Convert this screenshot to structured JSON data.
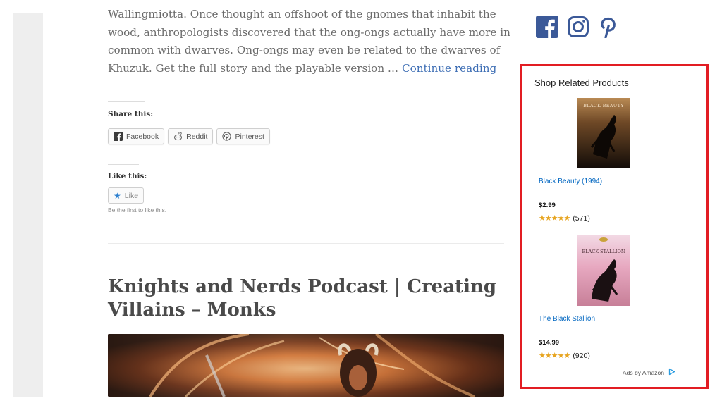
{
  "article": {
    "excerpt_lines": [
      "Wallingmiotta. Once thought an offshoot of the gnomes that inhabit the",
      "wood, anthropologists discovered that the ong-ongs actually have more in",
      "common with dwarves. Ong-ongs may even be related to the dwarves of",
      "Khuzuk. Get the full story and the playable version …"
    ],
    "continue_reading": "Continue reading"
  },
  "share": {
    "title": "Share this:",
    "buttons": [
      {
        "label": "Facebook",
        "icon": "facebook-icon"
      },
      {
        "label": "Reddit",
        "icon": "reddit-icon"
      },
      {
        "label": "Pinterest",
        "icon": "pinterest-icon"
      }
    ]
  },
  "like": {
    "title": "Like this:",
    "button_label": "Like",
    "note": "Be the first to like this."
  },
  "next_post": {
    "title_line1": "Knights and Nerds Podcast | Creating",
    "title_line2": "Villains – Monks"
  },
  "social": {
    "icons": [
      "facebook-icon",
      "instagram-icon",
      "pinterest-icon"
    ],
    "color": "#3b5998"
  },
  "shop": {
    "title": "Shop Related Products",
    "border_color": "#e21d23",
    "products": [
      {
        "cover_text": "BLACK BEAUTY",
        "name": "Black Beauty (1994)",
        "price": "$2.99",
        "rating": 4.5,
        "reviews": "(571)"
      },
      {
        "cover_text": "BLACK STALLION",
        "name": "The Black Stallion",
        "price": "$14.99",
        "rating": 4.5,
        "reviews": "(920)"
      }
    ],
    "ads_by": "Ads by Amazon"
  }
}
